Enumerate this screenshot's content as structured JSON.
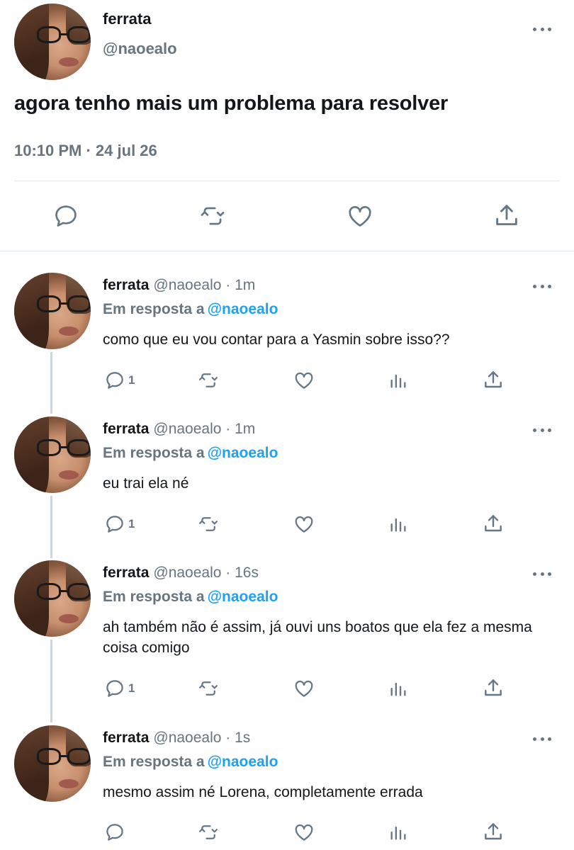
{
  "main_tweet": {
    "name": "ferrata",
    "handle": "@naoealo",
    "text": "agora tenho mais um problema para resolver",
    "meta": "10:10 PM · 24 jul 26"
  },
  "replies": [
    {
      "name": "ferrata",
      "meta": "@naoealo · 1m",
      "reply_label": "Em resposta a",
      "reply_handle": "@naoealo",
      "text": "como que eu vou contar para a Yasmin sobre isso??",
      "reply_count": "1"
    },
    {
      "name": "ferrata",
      "meta": "@naoealo · 1m",
      "reply_label": "Em resposta a",
      "reply_handle": "@naoealo",
      "text": "eu trai ela né",
      "reply_count": "1"
    },
    {
      "name": "ferrata",
      "meta": "@naoealo · 16s",
      "reply_label": "Em resposta a",
      "reply_handle": "@naoealo",
      "text": "ah também não é assim, já ouvi uns boatos que ela fez a mesma coisa comigo",
      "reply_count": "1"
    },
    {
      "name": "ferrata",
      "meta": "@naoealo · 1s",
      "reply_label": "Em resposta a",
      "reply_handle": "@naoealo",
      "text": "mesmo assim né Lorena, completamente errada",
      "reply_count": ""
    }
  ],
  "icons": {
    "reply": "speech-bubble-icon",
    "retweet": "retweet-arrows-icon",
    "like": "heart-icon",
    "analytics": "bar-chart-icon",
    "share": "share-upload-icon",
    "more": "more-dots-icon"
  },
  "colors": {
    "link": "#1da1f2",
    "muted": "#66757f",
    "icon": "#657786",
    "text": "#14171a"
  }
}
